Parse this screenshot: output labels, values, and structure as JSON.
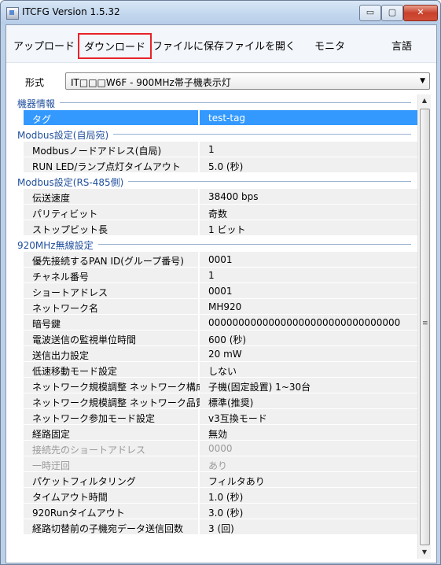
{
  "window": {
    "title": "ITCFG Version 1.5.32",
    "controls": {
      "minimize": "▭",
      "maximize": "▢",
      "close": "✕"
    }
  },
  "menu": [
    {
      "label": "アップロード"
    },
    {
      "label": "ダウンロード",
      "highlighted": true
    },
    {
      "label": "ファイルに保存"
    },
    {
      "label": "ファイルを開く"
    },
    {
      "label": "モニタ"
    },
    {
      "label": "言語"
    }
  ],
  "form": {
    "label": "形式",
    "selected": "IT□□□W6F - 900MHz帯子機表示灯",
    "arrow": "▼"
  },
  "scrollbar": {
    "up": "▲",
    "down": "▼",
    "grip": "≡"
  },
  "categories": [
    {
      "title": "機器情報",
      "rows": [
        {
          "name": "タグ",
          "value": "test-tag",
          "selected": true
        }
      ]
    },
    {
      "title": "Modbus設定(自局宛)",
      "rows": [
        {
          "name": "Modbusノードアドレス(自局)",
          "value": "1"
        },
        {
          "name": "RUN LED/ランプ点灯タイムアウト",
          "value": "5.0 (秒)"
        }
      ]
    },
    {
      "title": "Modbus設定(RS-485側)",
      "rows": [
        {
          "name": "伝送速度",
          "value": "38400 bps"
        },
        {
          "name": "パリティビット",
          "value": "奇数"
        },
        {
          "name": "ストップビット長",
          "value": "1 ビット"
        }
      ]
    },
    {
      "title": "920MHz無線設定",
      "rows": [
        {
          "name": "優先接続するPAN ID(グループ番号)",
          "value": "0001"
        },
        {
          "name": "チャネル番号",
          "value": "1"
        },
        {
          "name": "ショートアドレス",
          "value": "0001"
        },
        {
          "name": "ネットワーク名",
          "value": "MH920"
        },
        {
          "name": "暗号鍵",
          "value": "00000000000000000000000000000000"
        },
        {
          "name": "電波送信の監視単位時間",
          "value": "600 (秒)"
        },
        {
          "name": "送信出力設定",
          "value": "20 mW"
        },
        {
          "name": "低速移動モード設定",
          "value": "しない"
        },
        {
          "name": "ネットワーク規模調整 ネットワーク構成",
          "value": "子機(固定設置) 1~30台"
        },
        {
          "name": "ネットワーク規模調整 ネットワーク品質設定",
          "value": "標準(推奨)"
        },
        {
          "name": "ネットワーク参加モード設定",
          "value": "v3互換モード"
        },
        {
          "name": "経路固定",
          "value": "無効"
        },
        {
          "name": "接続先のショートアドレス",
          "value": "0000",
          "disabled": true
        },
        {
          "name": "一時迂回",
          "value": "あり",
          "disabled": true
        },
        {
          "name": "パケットフィルタリング",
          "value": "フィルタあり"
        },
        {
          "name": "タイムアウト時間",
          "value": "1.0 (秒)"
        },
        {
          "name": "920Runタイムアウト",
          "value": "3.0 (秒)"
        },
        {
          "name": "経路切替前の子機宛データ送信回数",
          "value": "3 (回)"
        }
      ]
    }
  ]
}
